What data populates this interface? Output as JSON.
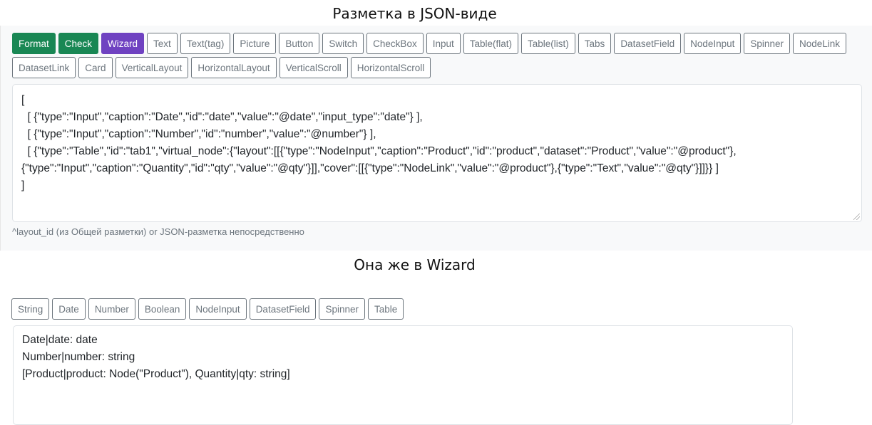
{
  "titles": {
    "top": "Разметка в JSON-виде",
    "bottom": "Она же в Wizard"
  },
  "toolbar_top": {
    "buttons": [
      {
        "label": "Format",
        "style": "green"
      },
      {
        "label": "Check",
        "style": "green"
      },
      {
        "label": "Wizard",
        "style": "purple"
      },
      {
        "label": "Text"
      },
      {
        "label": "Text(tag)"
      },
      {
        "label": "Picture"
      },
      {
        "label": "Button"
      },
      {
        "label": "Switch"
      },
      {
        "label": "CheckBox"
      },
      {
        "label": "Input"
      },
      {
        "label": "Table(flat)"
      },
      {
        "label": "Table(list)"
      },
      {
        "label": "Tabs"
      },
      {
        "label": "DatasetField"
      },
      {
        "label": "NodeInput"
      },
      {
        "label": "Spinner"
      },
      {
        "label": "NodeLink"
      },
      {
        "label": "DatasetLink"
      },
      {
        "label": "Card"
      },
      {
        "label": "VerticalLayout"
      },
      {
        "label": "HorizontalLayout"
      },
      {
        "label": "VerticalScroll"
      },
      {
        "label": "HorizontalScroll"
      }
    ]
  },
  "json_editor": {
    "lines": [
      "[",
      "  [ {\"type\":\"Input\",\"caption\":\"Date\",\"id\":\"date\",\"value\":\"@date\",\"input_type\":\"date\"} ],",
      "  [ {\"type\":\"Input\",\"caption\":\"Number\",\"id\":\"number\",\"value\":\"@number\"} ],",
      "  [ {\"type\":\"Table\",\"id\":\"tab1\",\"virtual_node\":{\"layout\":[[{\"type\":\"NodeInput\",\"caption\":\"Product\",\"id\":\"product\",\"dataset\":\"Product\",\"value\":\"@product\"},",
      "{\"type\":\"Input\",\"caption\":\"Quantity\",\"id\":\"qty\",\"value\":\"@qty\"}]],\"cover\":[[{\"type\":\"NodeLink\",\"value\":\"@product\"},{\"type\":\"Text\",\"value\":\"@qty\"}]]}} ]",
      "]"
    ],
    "hint": "^layout_id (из Общей разметки) or JSON-разметка непосредственно"
  },
  "toolbar_bottom": {
    "buttons": [
      {
        "label": "String"
      },
      {
        "label": "Date"
      },
      {
        "label": "Number"
      },
      {
        "label": "Boolean"
      },
      {
        "label": "NodeInput"
      },
      {
        "label": "DatasetField"
      },
      {
        "label": "Spinner"
      },
      {
        "label": "Table"
      }
    ]
  },
  "wizard_editor": {
    "lines": [
      "Date|date: date",
      "Number|number: string",
      "[Product|product: Node(\"Product\"), Quantity|qty: string]"
    ]
  },
  "colors": {
    "green": "#198754",
    "purple": "#6f42c1",
    "outline": "#6c757d"
  }
}
